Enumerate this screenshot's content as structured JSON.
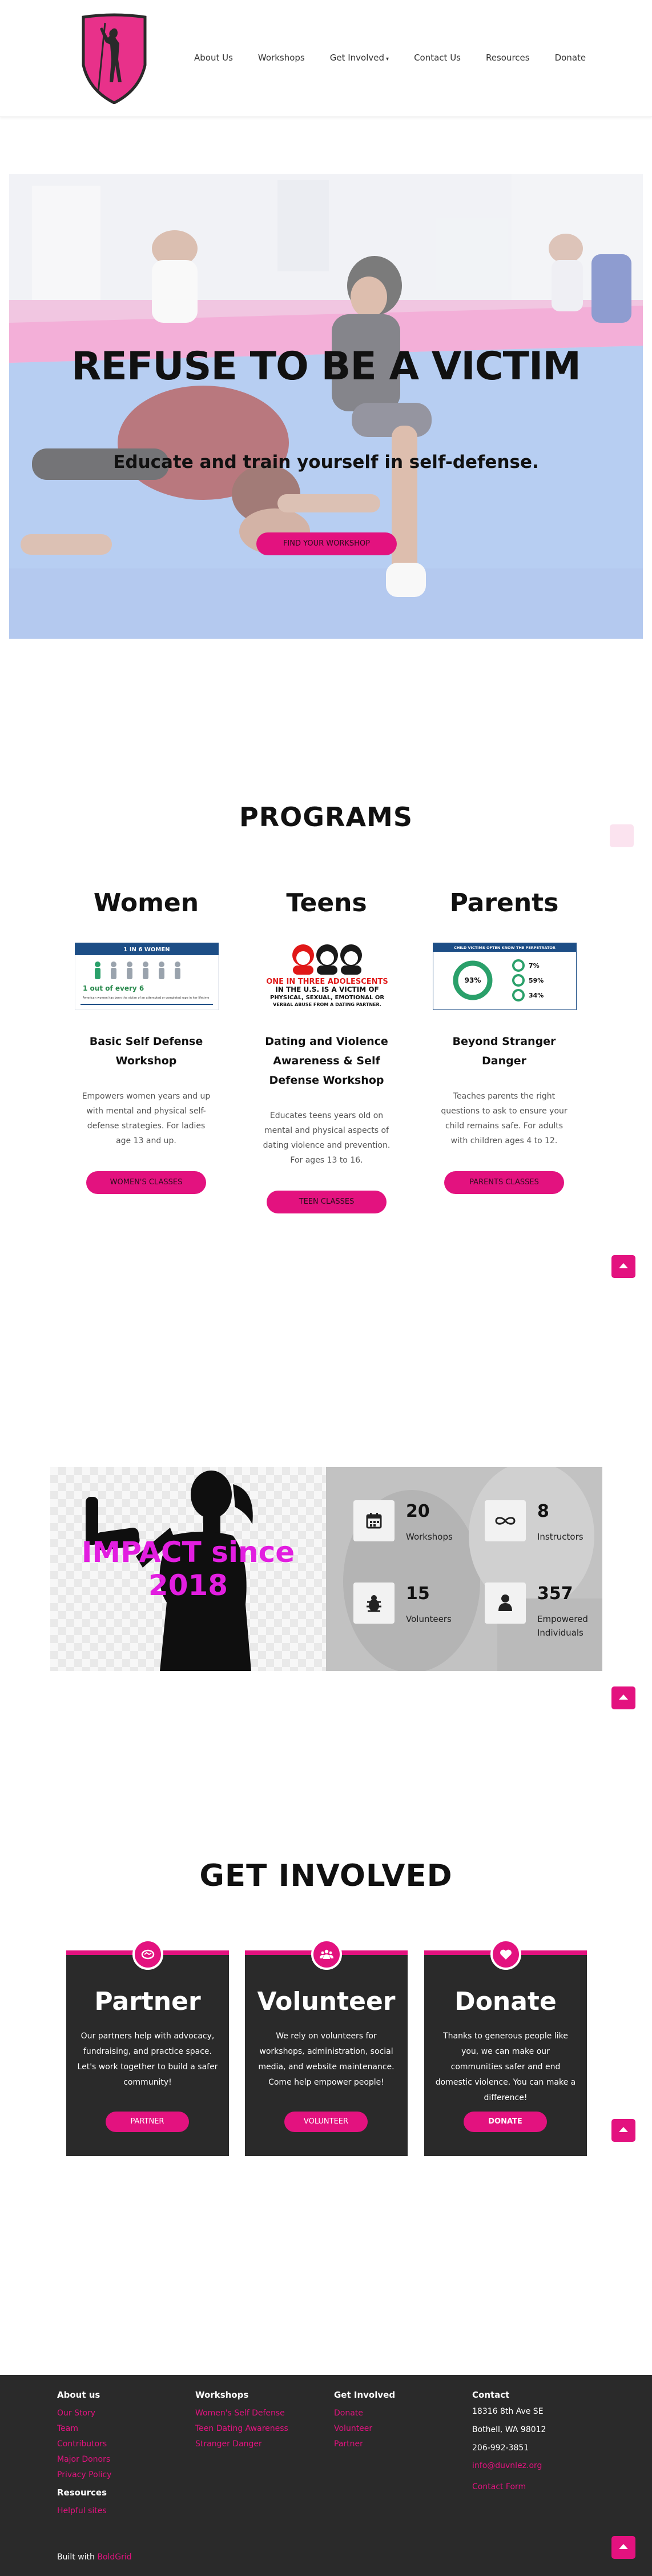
{
  "nav": {
    "items": [
      {
        "label": "About Us"
      },
      {
        "label": "Workshops"
      },
      {
        "label": "Get Involved"
      },
      {
        "label": "Contact Us"
      },
      {
        "label": "Resources"
      },
      {
        "label": "Donate"
      }
    ]
  },
  "hero": {
    "title": "REFUSE TO BE A VICTIM",
    "subtitle": "Educate and train yourself in self-defense.",
    "button": "FIND YOUR WORKSHOP"
  },
  "programs": {
    "title": "PROGRAMS",
    "columns": [
      {
        "heading": "Women",
        "image": {
          "banner": "1 IN 6 WOMEN",
          "line1": "1 out of every 6",
          "line2": "American women has been the victim of an attempted or completed rape in her lifetime"
        },
        "name": "Basic Self Defense Workshop",
        "description": "Empowers women years and up with mental and physical self-defense strategies.  For ladies age 13 and up.",
        "button": "WOMEN'S CLASSES"
      },
      {
        "heading": "Teens",
        "image": {
          "line1": "ONE IN THREE ADOLESCENTS",
          "line2": "IN THE U.S. IS A VICTIM OF",
          "line3": "PHYSICAL, SEXUAL, EMOTIONAL OR",
          "line4": "VERBAL ABUSE FROM A DATING PARTNER."
        },
        "name": "Dating and Violence Awareness & Self Defense Workshop",
        "description": "Educates teens years old on mental and physical aspects of dating violence and prevention. For ages 13 to 16.",
        "button": "TEEN CLASSES"
      },
      {
        "heading": "Parents",
        "image": {
          "banner": "CHILD VICTIMS OFTEN KNOW THE PERPETRATOR",
          "center": "93%",
          "stat1": "7%",
          "stat2": "59%",
          "stat3": "34%"
        },
        "name": "Beyond Stranger Danger",
        "description": "Teaches parents the right questions to ask to ensure your child remains safe. For adults with children ages 4 to 12.",
        "button": "PARENTS CLASSES"
      }
    ]
  },
  "impact": {
    "title": "IMPACT since 2018",
    "stats": [
      {
        "icon": "calendar-icon",
        "value": "20",
        "label": "Workshops"
      },
      {
        "icon": "infinity-icon",
        "value": "8",
        "label": "Instructors"
      },
      {
        "icon": "bug-icon",
        "value": "15",
        "label": "Volunteers"
      },
      {
        "icon": "person-icon",
        "value": "357",
        "label": "Empowered Individuals"
      }
    ]
  },
  "get_involved": {
    "title": "GET INVOLVED",
    "cards": [
      {
        "icon": "handshake-icon",
        "heading": "Partner",
        "description": "Our partners help with advocacy, fundraising, and practice space. Let's work together to build a safer community!",
        "button": "PARTNER"
      },
      {
        "icon": "people-icon",
        "heading": "Volunteer",
        "description": "We rely on volunteers for workshops, administration, social media, and website maintenance. Come help empower people!",
        "button": "VOLUNTEER"
      },
      {
        "icon": "heart-icon",
        "heading": "Donate",
        "description": "Thanks to generous people like you, we can make our communities safer and end domestic violence. You can make a difference!",
        "button": "DONATE"
      }
    ]
  },
  "footer": {
    "about": {
      "heading": "About us",
      "links": [
        "Our Story",
        "Team",
        "Contributors",
        "Major Donors",
        "Privacy Policy"
      ]
    },
    "resources": {
      "heading": "Resources",
      "links": [
        "Helpful sites"
      ]
    },
    "workshops": {
      "heading": "Workshops",
      "links": [
        "Women's Self Defense",
        "Teen Dating Awareness",
        "Stranger Danger"
      ]
    },
    "get_involved": {
      "heading": "Get Involved",
      "links": [
        "Donate",
        "Volunteer",
        "Partner"
      ]
    },
    "contact": {
      "heading": "Contact",
      "address1": "18316 8th Ave SE",
      "address2": "Bothell, WA 98012",
      "phone": "206-992-3851",
      "email": "info@duvnlez.org",
      "form": "Contact Form"
    },
    "built_prefix": "Built with",
    "built_brand": "BoldGrid"
  },
  "colors": {
    "accent": "#e3127f",
    "dark": "#2a2a2a",
    "impact_text": "#e21ee0"
  }
}
